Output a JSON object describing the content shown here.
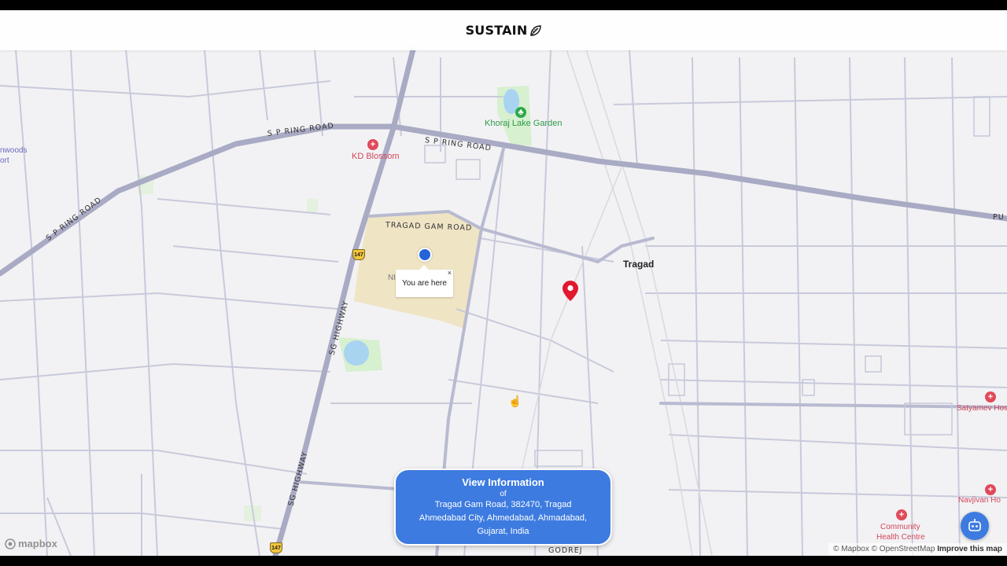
{
  "header": {
    "brand": "SUSTAIN",
    "brand_icon": "leaf-icon"
  },
  "roads": {
    "ring_road_top": "S P RING ROAD",
    "ring_road_mid": "S P RING ROAD",
    "ring_road_left": "S P RING ROAD",
    "tragad_gam_road": "TRAGAD GAM ROAD",
    "sg_highway_upper": "SG HIGHWAY",
    "sg_highway_lower": "SG HIGHWAY",
    "shield_upper": "147",
    "shield_lower": "147",
    "ring_right_edge": "PU",
    "bottom_road": "GODREJ"
  },
  "places": {
    "khoraj_lake_garden": "Khoraj Lake Garden",
    "kd_blossom": "KD Blossom",
    "tragad": "Tragad",
    "left_edge_top": "nwoods",
    "left_edge_bottom": "ort",
    "satyamev": "Satyamev Hos",
    "navjivan": "Navjivan Ho",
    "community_health_line1": "Community",
    "community_health_line2": "Health Centre",
    "ni_partial": "NI"
  },
  "popup": {
    "text": "You are here",
    "close": "×"
  },
  "info_card": {
    "title": "View Information",
    "of": "of",
    "address_line1": "Tragad Gam Road, 382470, Tragad",
    "address_line2": "Ahmedabad City, Ahmedabad, Ahmadabad,",
    "address_line3": "Gujarat, India"
  },
  "attribution": {
    "mapbox": "© Mapbox",
    "osm": "© OpenStreetMap",
    "improve": "Improve this map"
  },
  "mapbox_logo": "mapbox",
  "colors": {
    "map_bg": "#f2f2f4",
    "major_road": "#a9aac4",
    "minor_road": "#c8cadb",
    "park": "#d7f0d0",
    "water": "#a8d4f2",
    "campus": "#efe4c4",
    "accent_blue": "#3d7be0",
    "marker_red": "#e0192e",
    "poi_red": "#e04a5a",
    "poi_green": "#2ea84a"
  }
}
